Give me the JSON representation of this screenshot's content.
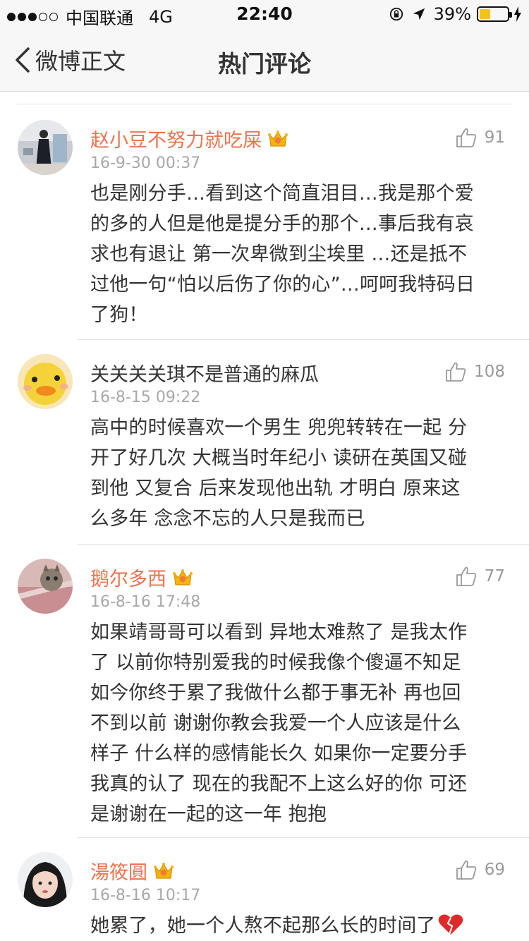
{
  "status_bar": {
    "signal_dots_full": 3,
    "signal_dots_empty": 2,
    "carrier": "中国联通",
    "network": "4G",
    "time": "22:40",
    "battery_percent": "39%",
    "battery_level": 0.39
  },
  "nav": {
    "back_label": "微博正文",
    "title": "热门评论"
  },
  "comments": [
    {
      "username": "赵小豆不努力就吃屎",
      "vip": true,
      "time": "16-9-30 00:37",
      "likes": "91",
      "text": "也是刚分手…看到这个简直泪目…我是那个爱的多的人但是他是提分手的那个…事后我有哀求也有退让 第一次卑微到尘埃里 …还是抵不过他一句“怕以后伤了你的心”…呵呵我特码日了狗！",
      "lines": [
        "也是刚分手…看到这个简直泪目…我是那个爱",
        "的多的人但是他是提分手的那个…事后我有哀",
        "求也有退让 第一次卑微到尘埃里 …还是抵不",
        "过他一句“怕以后伤了你的心”…呵呵我特码日",
        "了狗！"
      ]
    },
    {
      "username": "关关关关琪不是普通的麻瓜",
      "vip": false,
      "time": "16-8-15 09:22",
      "likes": "108",
      "lines": [
        "高中的时候喜欢一个男生 兜兜转转在一起 分",
        "开了好几次 大概当时年纪小 读研在英国又碰",
        "到他 又复合 后来发现他出轨 才明白 原来这",
        "么多年 念念不忘的人只是我而已"
      ]
    },
    {
      "username": "鹅尔多西",
      "vip": true,
      "time": "16-8-16 17:48",
      "likes": "77",
      "lines": [
        "如果靖哥哥可以看到 异地太难熬了 是我太作",
        "了 以前你特别爱我的时候我像个傻逼不知足",
        "如今你终于累了我做什么都于事无补 再也回",
        "不到以前 谢谢你教会我爱一个人应该是什么",
        "样子 什么样的感情能长久 如果你一定要分手",
        "我真的认了 现在的我配不上这么好的你 可还",
        "是谢谢在一起的这一年 抱抱"
      ]
    },
    {
      "username": "湯筱圓",
      "vip": true,
      "time": "16-8-16 10:17",
      "likes": "69",
      "lines": [
        "她累了，她一个人熬不起那么长的时间了"
      ],
      "trailing_emoji": "broken-heart-icon"
    }
  ],
  "colors": {
    "vip_name": "#eb7350",
    "timestamp": "#a8a8a8",
    "nav_bg": "#f7f7f7"
  }
}
